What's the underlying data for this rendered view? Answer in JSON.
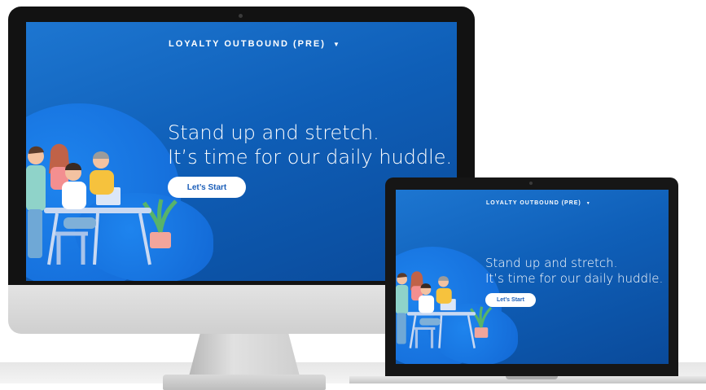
{
  "desktop": {
    "nav_title": "LOYALTY OUTBOUND (PRE)",
    "headline_line1": "Stand up and stretch.",
    "headline_line2": "It’s time for our daily huddle.",
    "start_button": "Let’s Start"
  },
  "laptop": {
    "nav_title": "LOYALTY OUTBOUND (PRE)",
    "headline_line1": "Stand up and stretch.",
    "headline_line2": "It’s time for our daily huddle.",
    "start_button": "Let’s Start"
  },
  "icons": {
    "dropdown": "caret-down-icon",
    "illustration": "team-huddle-illustration"
  },
  "colors": {
    "screen_background": "#0f5fb8",
    "button_text": "#1b5eb8"
  }
}
